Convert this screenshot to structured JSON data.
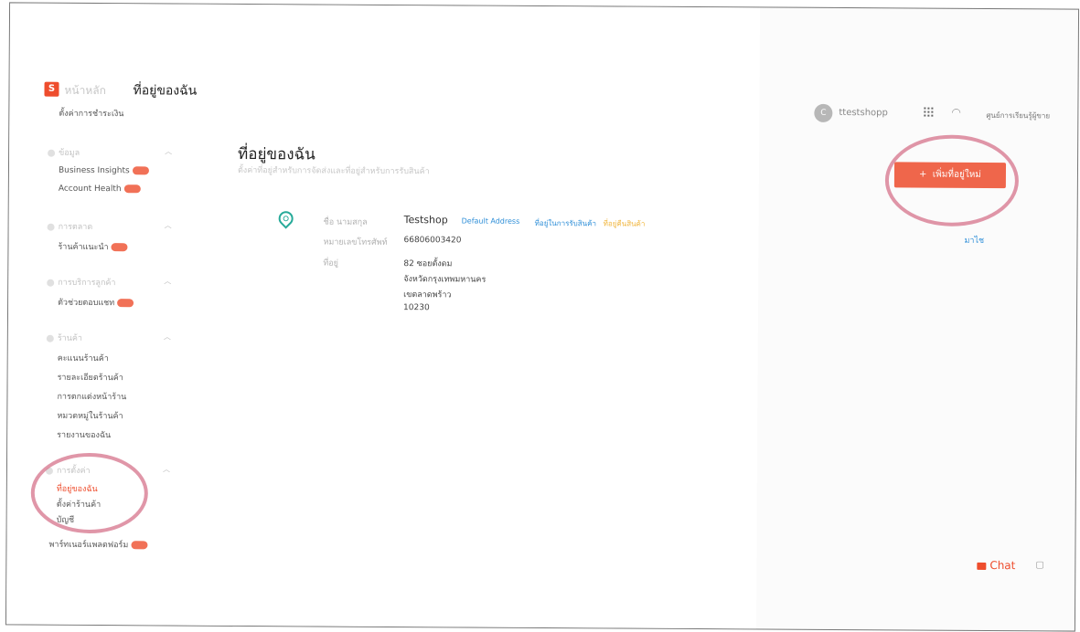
{
  "header": {
    "logo_letter": "S",
    "home_label": "หน้าหลัก",
    "breadcrumb_current": "ที่อยู่ของฉัน",
    "user_initial": "C",
    "username": "ttestshopp",
    "seller_center": "ศูนย์การเรียนรู้ผู้ขาย"
  },
  "sidebar": {
    "top_item": "ตั้งค่าการชำระเงิน",
    "sections": [
      {
        "title": "ข้อมูล",
        "items": [
          {
            "label": "Business Insights",
            "badge": true
          },
          {
            "label": "Account Health",
            "badge": true
          }
        ]
      },
      {
        "title": "การตลาด",
        "items": [
          {
            "label": "ร้านค้าแนะนำ",
            "badge": true
          }
        ]
      },
      {
        "title": "การบริการลูกค้า",
        "items": [
          {
            "label": "ตัวช่วยตอบแชท",
            "badge": true
          }
        ]
      },
      {
        "title": "ร้านค้า",
        "items": [
          {
            "label": "คะแนนร้านค้า"
          },
          {
            "label": "รายละเอียดร้านค้า"
          },
          {
            "label": "การตกแต่งหน้าร้าน"
          },
          {
            "label": "หมวดหมู่ในร้านค้า"
          },
          {
            "label": "รายงานของฉัน"
          }
        ]
      },
      {
        "title": "การตั้งค่า",
        "items": [
          {
            "label": "ที่อยู่ของฉัน",
            "active": true
          },
          {
            "label": "ตั้งค่าร้านค้า"
          },
          {
            "label": "บัญชี"
          }
        ]
      }
    ],
    "bottom_item": "พาร์ทเนอร์แพลตฟอร์ม"
  },
  "main": {
    "title": "ที่อยู่ของฉัน",
    "subtitle": "ตั้งค่าที่อยู่สำหรับการจัดส่งและที่อยู่สำหรับการรับสินค้า",
    "address": {
      "name_label": "ชื่อ นามสกุล",
      "name": "Testshop",
      "tag_default": "Default Address",
      "tag_pickup": "ที่อยู่ในการรับสินค้า",
      "tag_return": "ที่อยู่คืนสินค้า",
      "phone_label": "หมายเลขโทรศัพท์",
      "phone": "66806003420",
      "address_label": "ที่อยู่",
      "lines": [
        "82 ซอยตั้งดม",
        "จังหวัดกรุงเทพมหานคร",
        "เขตลาดพร้าว",
        "10230"
      ]
    }
  },
  "right": {
    "add_button": "เพิ่มที่อยู่ใหม่",
    "add_icon": "+",
    "help_link": "มาไช",
    "chat_label": "Chat"
  },
  "colors": {
    "brand": "#ee4d2d",
    "teal": "#26aa99",
    "link": "#2f8fd8",
    "annotation": "#d36a83"
  }
}
